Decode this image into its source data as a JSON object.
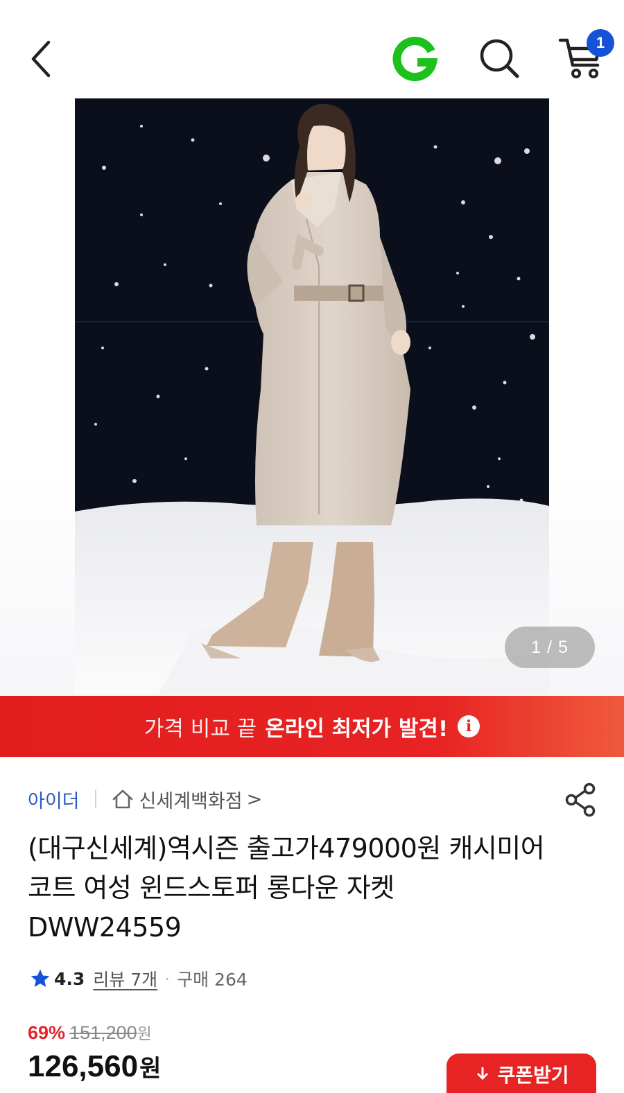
{
  "header": {
    "back_icon": "chevron-left-icon",
    "logo_icon": "g-logo-icon",
    "logo_color": "#1cc11c",
    "search_icon": "search-icon",
    "cart_icon": "cart-icon",
    "cart_count": "1",
    "badge_color": "#1652d8"
  },
  "gallery": {
    "current": "1",
    "separator": "/",
    "total": "5"
  },
  "promo_banner": {
    "text_light": "가격 비교 끝",
    "text_bold": "온라인 최저가 발견!",
    "info_icon_glyph": "i",
    "color": "#e82323"
  },
  "seller": {
    "brand": "아이더",
    "store_icon": "home-icon",
    "store": "신세계백화점",
    "store_chevron": ">",
    "share_icon": "share-icon"
  },
  "product": {
    "title": "(대구신세계)역시즌 출고가479000원 캐시미어 코트 여성 윈드스토퍼 롱다운 자켓 DWW24559"
  },
  "rating": {
    "star_icon": "star-icon",
    "star_color": "#1652d8",
    "score": "4.3",
    "reviews": "리뷰 7개",
    "dot": "·",
    "purchases": "구매 264"
  },
  "price": {
    "discount": "69%",
    "original": "151,200",
    "original_unit": "원",
    "sale": "126,560",
    "sale_unit": "원",
    "accent_color": "#e3262b"
  },
  "coupon_button": {
    "icon": "download-icon",
    "label": "쿠폰받기"
  }
}
